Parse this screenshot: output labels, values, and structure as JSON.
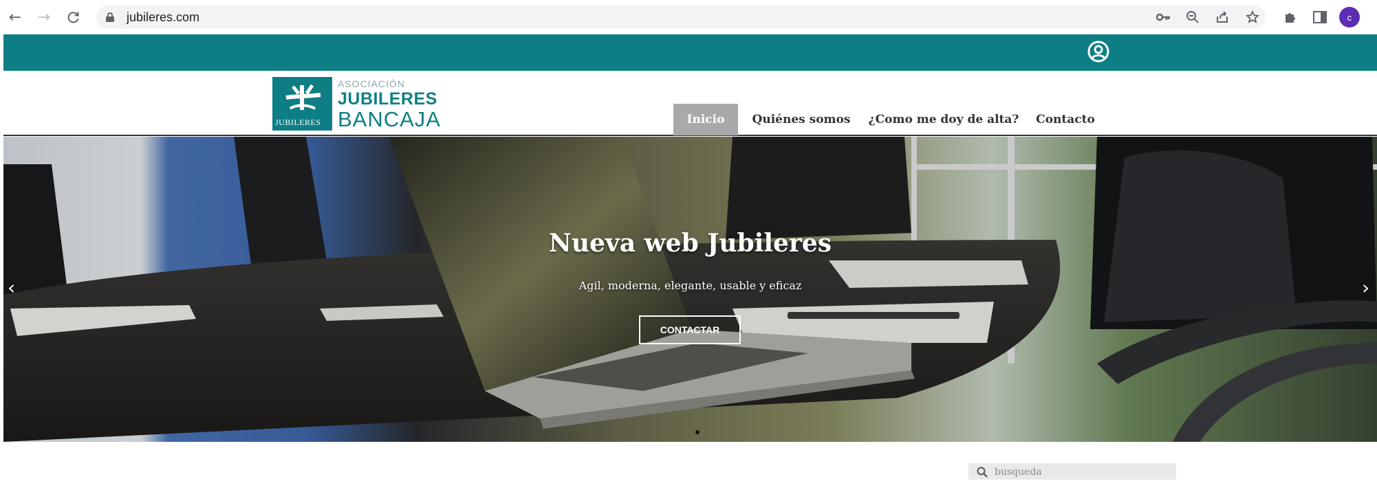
{
  "browser": {
    "url": "jubileres.com",
    "profile_initial": "c",
    "back_icon": "←",
    "forward_icon": "→",
    "reload_icon": "C",
    "tools": [
      "key-icon",
      "zoom-icon",
      "share-icon",
      "star-icon",
      "extensions-icon",
      "sidepanel-icon"
    ]
  },
  "colors": {
    "brand": "#0d7f84",
    "menu_active_bg": "#a9a9a9"
  },
  "logo": {
    "box_text": "JUBILERES",
    "line1": "ASOCIACIÓN",
    "line2": "JUBILERES",
    "line3": "BANCAJA"
  },
  "menu": {
    "items": [
      {
        "label": "Inicio",
        "active": true
      },
      {
        "label": "Quiénes somos",
        "active": false
      },
      {
        "label": "¿Como me doy de alta?",
        "active": false
      },
      {
        "label": "Contacto",
        "active": false
      }
    ]
  },
  "hero": {
    "title": "Nueva web Jubileres",
    "subtitle": "Agil, moderna, elegante, usable y eficaz",
    "button": "CONTACTAR",
    "prev": "‹",
    "next": "›"
  },
  "search": {
    "placeholder": "busqueda"
  }
}
